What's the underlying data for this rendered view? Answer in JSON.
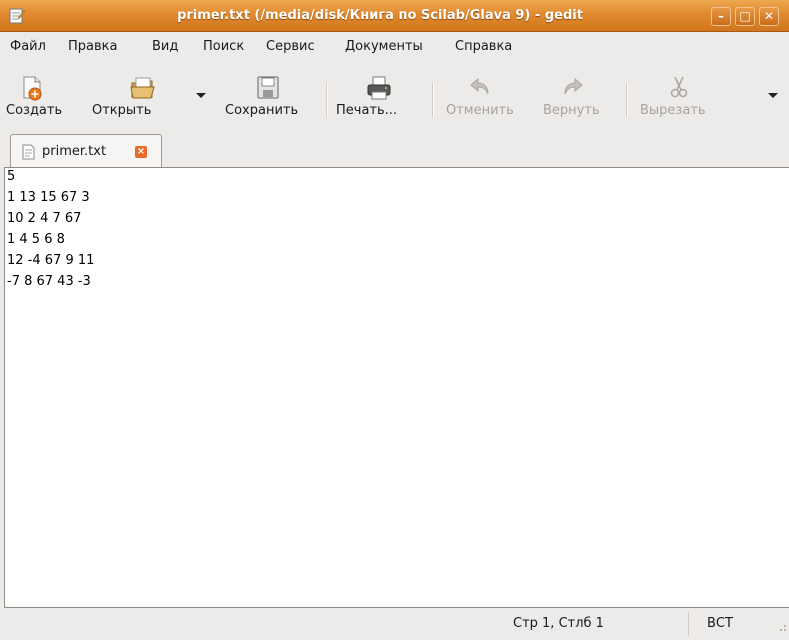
{
  "window": {
    "title": "primer.txt (/media/disk/Книга по Scilab/Glava 9) - gedit",
    "controls": [
      "minimize-icon",
      "maximize-icon",
      "close-icon"
    ]
  },
  "menu": {
    "items": [
      "Файл",
      "Правка",
      "Вид",
      "Поиск",
      "Сервис",
      "Документы",
      "Справка"
    ]
  },
  "toolbar": {
    "new_label": "Создать",
    "open_label": "Открыть",
    "save_label": "Сохранить",
    "print_label": "Печать...",
    "undo_label": "Отменить",
    "redo_label": "Вернуть",
    "cut_label": "Вырезать"
  },
  "tab": {
    "label": "primer.txt"
  },
  "editor": {
    "lines": [
      "5",
      "1 13 15 67 3",
      "10 2 4 7 67",
      "1 4 5 6 8",
      "12 -4 67 9 11",
      "-7 8 67 43 -3"
    ]
  },
  "status": {
    "position": "Стр 1, Стлб 1",
    "mode": "ВСТ"
  },
  "colors": {
    "titlebar": "#e08a2f",
    "tab_close": "#e46b2a",
    "editor_bg": "#ffffff"
  }
}
